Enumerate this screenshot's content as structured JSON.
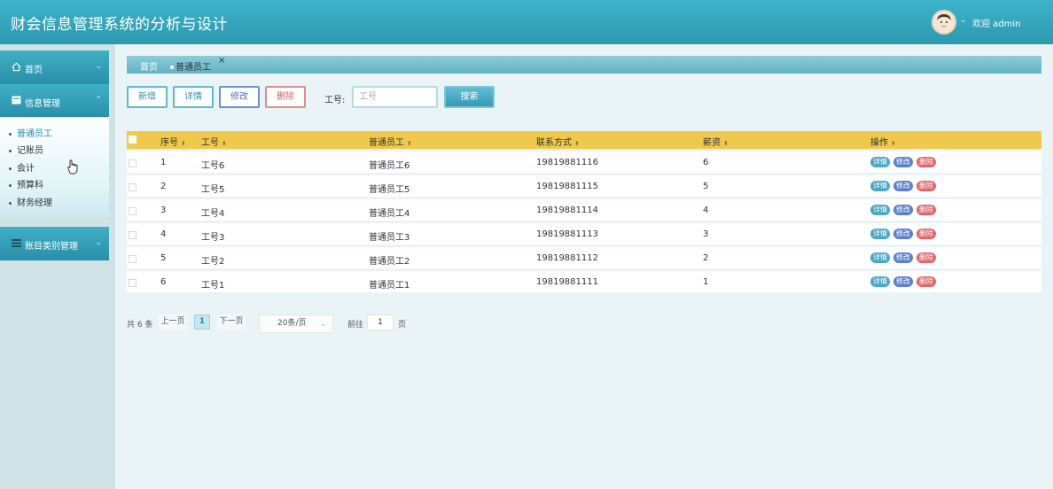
{
  "header": {
    "title": "财会信息管理系统的分析与设计",
    "welcome": "欢迎 admin",
    "chevron": "⌄"
  },
  "sidebar": {
    "home": {
      "icon": "home-icon",
      "label": "首页"
    },
    "info": {
      "icon": "list-icon",
      "label": "信息管理"
    },
    "info_items": [
      "普通员工",
      "记账员",
      "会计",
      "预算科",
      "财务经理"
    ],
    "account": {
      "icon": "menu-icon",
      "label": "账目类别管理"
    }
  },
  "tabs": {
    "home": "首页",
    "active": "普通员工",
    "close": "×"
  },
  "toolbar": {
    "add": "新增",
    "detail": "详情",
    "edit": "修改",
    "delete": "删除",
    "search_label": "工号:",
    "search_placeholder": "工号",
    "search": "搜索"
  },
  "table": {
    "headers": [
      "序号",
      "工号",
      "普通员工",
      "联系方式",
      "薪资",
      "操作"
    ],
    "rows": [
      [
        "1",
        "工号6",
        "普通员工6",
        "19819881116",
        "6"
      ],
      [
        "2",
        "工号5",
        "普通员工5",
        "19819881115",
        "5"
      ],
      [
        "3",
        "工号4",
        "普通员工4",
        "19819881114",
        "4"
      ],
      [
        "4",
        "工号3",
        "普通员工3",
        "19819881113",
        "3"
      ],
      [
        "5",
        "工号2",
        "普通员工2",
        "19819881112",
        "2"
      ],
      [
        "6",
        "工号1",
        "普通员工1",
        "19819881111",
        "1"
      ]
    ],
    "ops": {
      "detail": "详情",
      "edit": "修改",
      "delete": "删除"
    }
  },
  "pagination": {
    "total": "共 6 条",
    "prev": "上一页",
    "current": "1",
    "next": "下一页",
    "page_size": "20条/页",
    "goto": "前往",
    "goto_value": "1",
    "page_unit": "页"
  }
}
